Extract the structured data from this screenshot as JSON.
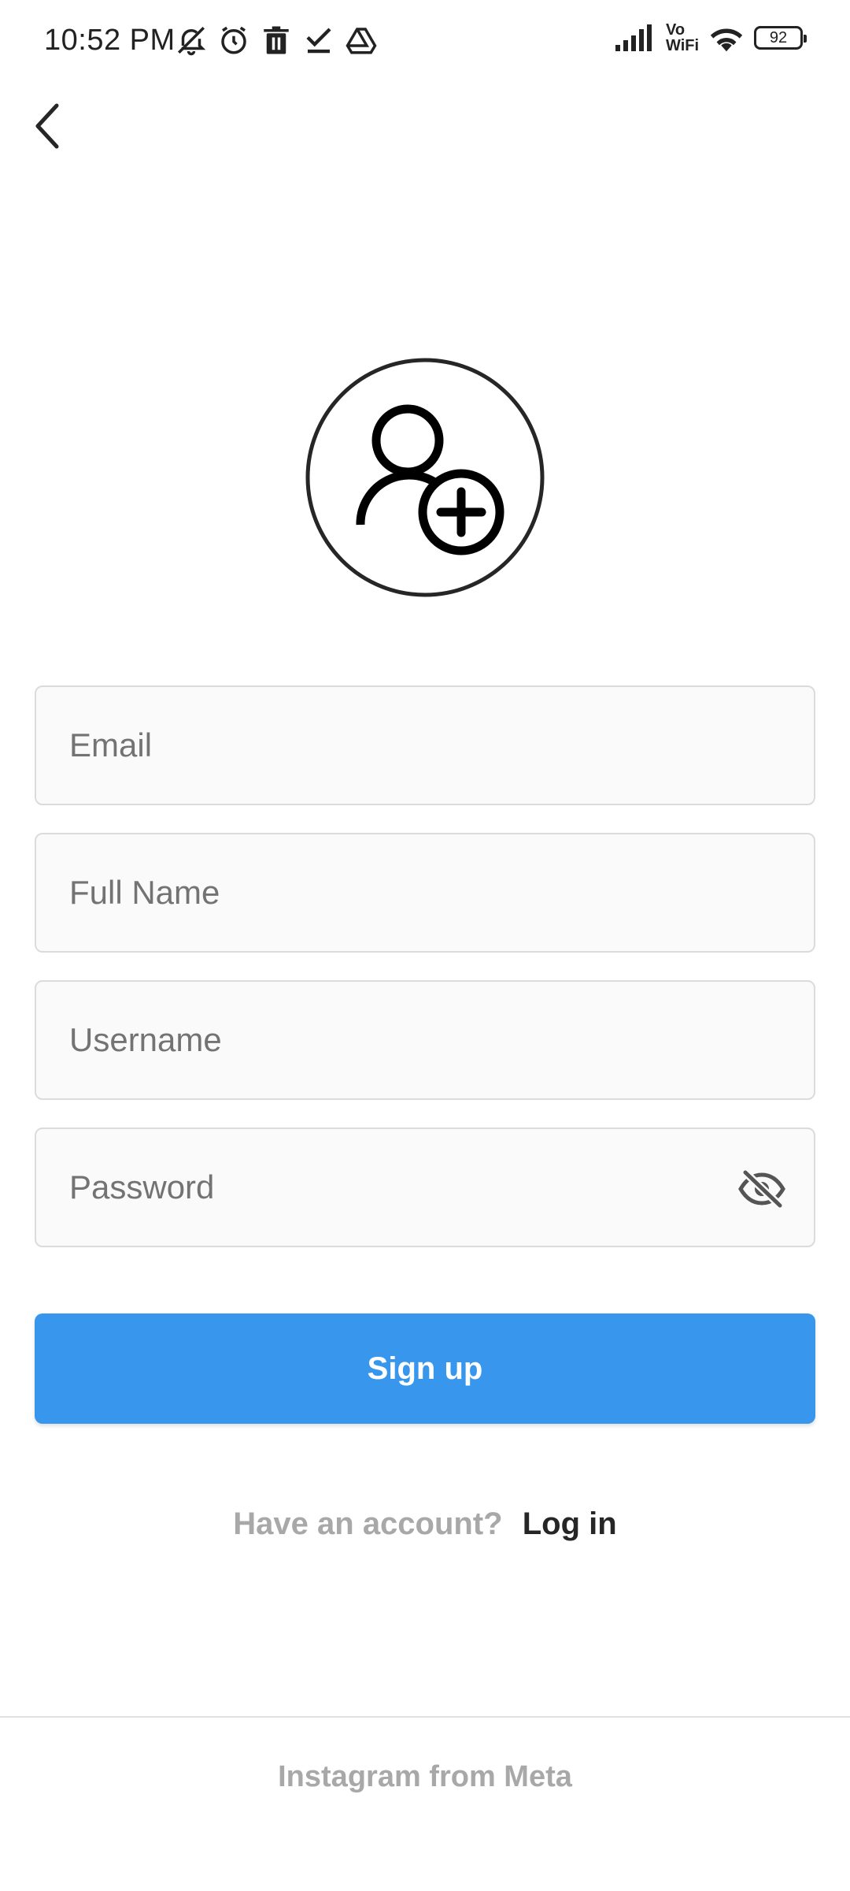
{
  "status_bar": {
    "time": "10:52 PM",
    "left_icons": [
      "bell-off-icon",
      "alarm-icon",
      "trash-icon",
      "check-icon",
      "drive-icon"
    ],
    "vowifi_line1": "Vo",
    "vowifi_line2": "WiFi",
    "battery_level": "92"
  },
  "header": {
    "back_icon": "chevron-left-icon"
  },
  "avatar": {
    "icon": "add-user-icon"
  },
  "form": {
    "email_placeholder": "Email",
    "full_name_placeholder": "Full Name",
    "username_placeholder": "Username",
    "password_placeholder": "Password",
    "password_toggle_icon": "eye-off-icon",
    "signup_label": "Sign up"
  },
  "login": {
    "prompt": "Have an account?",
    "link": "Log in"
  },
  "footer": {
    "text": "Instagram from Meta"
  },
  "colors": {
    "primary_button": "#3897ec",
    "field_bg": "#fafafa",
    "field_border": "#dbdbdb",
    "muted_text": "#a8a8a8"
  }
}
